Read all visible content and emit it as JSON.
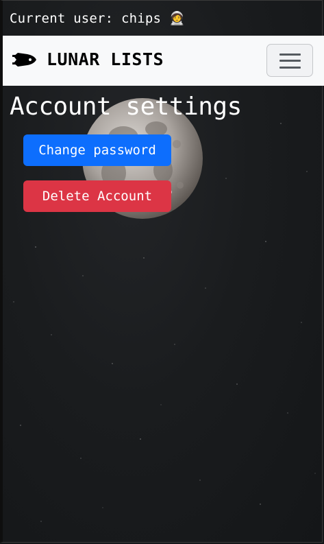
{
  "user_bar": {
    "label": "Current user: chips 🧑‍🚀"
  },
  "navbar": {
    "brand": "LUNAR LISTS",
    "brand_icon": "space-shuttle-icon",
    "toggler_icon": "hamburger-menu-icon"
  },
  "main": {
    "title": "Account settings",
    "change_password_label": "Change password",
    "delete_account_label": "Delete Account"
  },
  "colors": {
    "primary": "#0d6efd",
    "danger": "#dc3545",
    "navbar_bg": "#f8f9fa",
    "background": "#1a1c1e"
  }
}
